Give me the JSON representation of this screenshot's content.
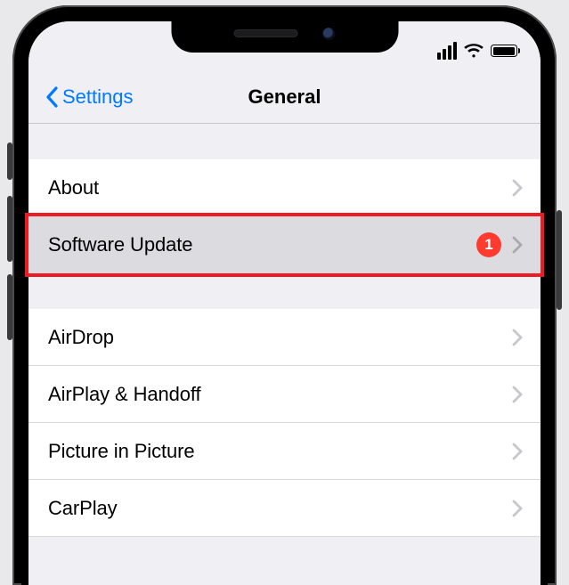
{
  "nav": {
    "back_label": "Settings",
    "title": "General"
  },
  "groups": [
    {
      "rows": [
        {
          "label": "About",
          "badge": null,
          "highlighted": false
        },
        {
          "label": "Software Update",
          "badge": "1",
          "highlighted": true
        }
      ]
    },
    {
      "rows": [
        {
          "label": "AirDrop",
          "badge": null,
          "highlighted": false
        },
        {
          "label": "AirPlay & Handoff",
          "badge": null,
          "highlighted": false
        },
        {
          "label": "Picture in Picture",
          "badge": null,
          "highlighted": false
        },
        {
          "label": "CarPlay",
          "badge": null,
          "highlighted": false
        }
      ]
    }
  ],
  "colors": {
    "tint": "#007aff",
    "badge": "#ff3b30",
    "highlight_border": "#ec1c24"
  }
}
